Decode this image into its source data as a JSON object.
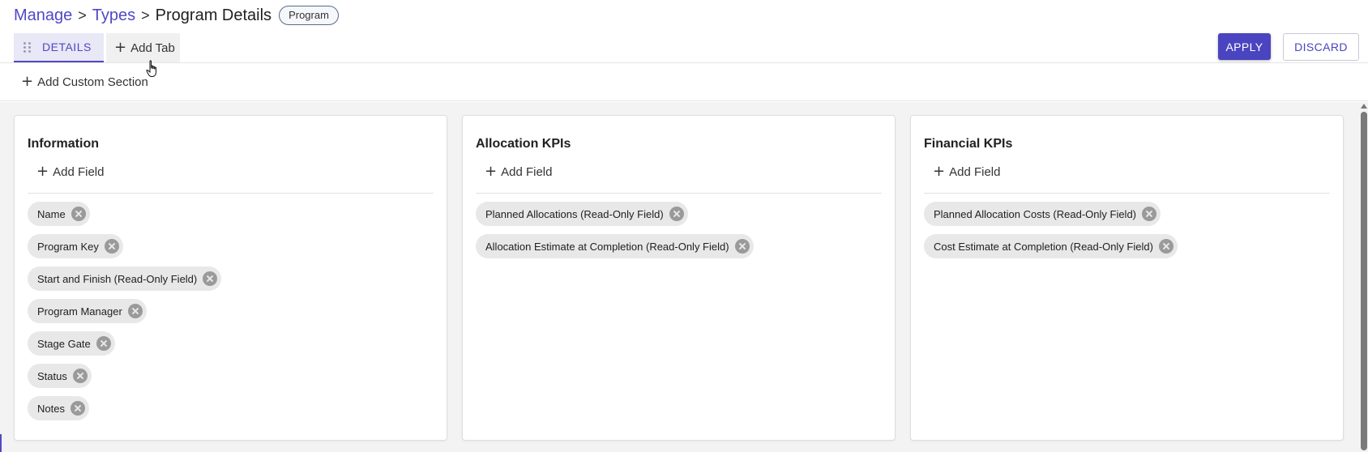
{
  "breadcrumb": {
    "manage": "Manage",
    "types": "Types",
    "current": "Program Details",
    "separator": ">",
    "badge": "Program"
  },
  "tabs": {
    "details_label": "DETAILS",
    "add_tab_label": "Add Tab",
    "plus": "+"
  },
  "actions": {
    "apply_label": "APPLY",
    "discard_label": "DISCARD"
  },
  "custom_section": {
    "add_label": "Add Custom Section"
  },
  "colors": {
    "accent": "#5048c6",
    "apply_bg": "#4b44c0",
    "chip_bg": "#e8e8e8",
    "content_bg": "#f3f3f3"
  },
  "sections": [
    {
      "title": "Information",
      "add_field_label": "Add Field",
      "fields": [
        "Name",
        "Program Key",
        "Start and Finish (Read-Only Field)",
        "Program Manager",
        "Stage Gate",
        "Status",
        "Notes"
      ]
    },
    {
      "title": "Allocation KPIs",
      "add_field_label": "Add Field",
      "fields": [
        "Planned Allocations (Read-Only Field)",
        "Allocation Estimate at Completion (Read-Only Field)"
      ]
    },
    {
      "title": "Financial KPIs",
      "add_field_label": "Add Field",
      "fields": [
        "Planned Allocation Costs (Read-Only Field)",
        "Cost Estimate at Completion (Read-Only Field)"
      ]
    }
  ],
  "icons": {
    "drag": "drag-handle-icon",
    "plus": "plus-icon",
    "chevron": "chevron-right-icon",
    "remove": "remove-circle-icon",
    "cursor": "hand-pointer-cursor"
  }
}
